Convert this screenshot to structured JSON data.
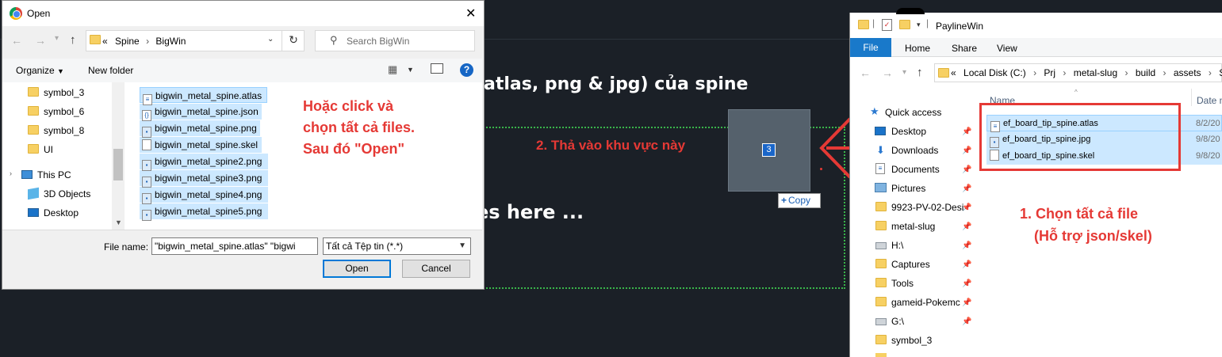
{
  "background_page": {
    "heading_fragment": "atlas, png & jpg) của spine",
    "drop_text_fragment": "es here ...",
    "drop_hint": "2. Thả vào khu vực này",
    "drag_count": "3",
    "copy_tooltip": "Copy",
    "colors": {
      "dropzone_border": "#39b54a",
      "annotation": "#e53935",
      "page_bg": "#1b2027"
    }
  },
  "open_dialog": {
    "title": "Open",
    "breadcrumb_prefix": "«",
    "breadcrumb": [
      "Spine",
      "BigWin"
    ],
    "search_placeholder": "Search BigWin",
    "toolbar": {
      "organize": "Organize",
      "new_folder": "New folder",
      "help": "?"
    },
    "nav_items": [
      {
        "label": "symbol_3",
        "icon": "folder-icon"
      },
      {
        "label": "symbol_6",
        "icon": "folder-icon"
      },
      {
        "label": "symbol_8",
        "icon": "folder-icon"
      },
      {
        "label": "UI",
        "icon": "folder-icon"
      },
      {
        "label": "This PC",
        "icon": "pc-icon"
      },
      {
        "label": "3D Objects",
        "icon": "cube-icon"
      },
      {
        "label": "Desktop",
        "icon": "desktop-icon"
      }
    ],
    "files": [
      {
        "name": "bigwin_metal_spine.atlas",
        "icon": "text-file-icon"
      },
      {
        "name": "bigwin_metal_spine.json",
        "icon": "json-file-icon"
      },
      {
        "name": "bigwin_metal_spine.png",
        "icon": "image-file-icon"
      },
      {
        "name": "bigwin_metal_spine.skel",
        "icon": "generic-file-icon"
      },
      {
        "name": "bigwin_metal_spine2.png",
        "icon": "image-file-icon"
      },
      {
        "name": "bigwin_metal_spine3.png",
        "icon": "image-file-icon"
      },
      {
        "name": "bigwin_metal_spine4.png",
        "icon": "image-file-icon"
      },
      {
        "name": "bigwin_metal_spine5.png",
        "icon": "image-file-icon"
      }
    ],
    "annotation": "Hoặc click và\nchọn tất cả files.\nSau đó \"Open\"",
    "file_name_label": "File name:",
    "file_name_value": "\"bigwin_metal_spine.atlas\" \"bigwi",
    "file_type_value": "Tất cả Tệp tin (*.*)",
    "open_button": "Open",
    "cancel_button": "Cancel"
  },
  "explorer": {
    "title": "PaylineWin",
    "tabs": [
      "File",
      "Home",
      "Share",
      "View"
    ],
    "address_prefix": "«",
    "address": [
      "Local Disk (C:)",
      "Prj",
      "metal-slug",
      "build",
      "assets",
      "S"
    ],
    "nav_items": [
      {
        "label": "Quick access",
        "icon": "star-icon",
        "pinned": false
      },
      {
        "label": "Desktop",
        "icon": "desktop-icon",
        "pinned": true
      },
      {
        "label": "Downloads",
        "icon": "download-icon",
        "pinned": true
      },
      {
        "label": "Documents",
        "icon": "documents-icon",
        "pinned": true
      },
      {
        "label": "Pictures",
        "icon": "pictures-icon",
        "pinned": true
      },
      {
        "label": "9923-PV-02-Desi",
        "icon": "folder-icon",
        "pinned": true
      },
      {
        "label": "metal-slug",
        "icon": "folder-icon",
        "pinned": true
      },
      {
        "label": "H:\\",
        "icon": "drive-icon",
        "pinned": true
      },
      {
        "label": "Captures",
        "icon": "folder-icon",
        "pinned": true
      },
      {
        "label": "Tools",
        "icon": "folder-icon",
        "pinned": true
      },
      {
        "label": "gameid-Pokemc",
        "icon": "folder-icon",
        "pinned": true
      },
      {
        "label": "G:\\",
        "icon": "drive-icon",
        "pinned": true
      },
      {
        "label": "symbol_3",
        "icon": "folder-icon",
        "pinned": false
      }
    ],
    "columns": {
      "name": "Name",
      "date": "Date m"
    },
    "files": [
      {
        "name": "ef_board_tip_spine.atlas",
        "date": "8/2/20",
        "icon": "text-file-icon"
      },
      {
        "name": "ef_board_tip_spine.jpg",
        "date": "9/8/20",
        "icon": "image-file-icon"
      },
      {
        "name": "ef_board_tip_spine.skel",
        "date": "9/8/20",
        "icon": "generic-file-icon"
      }
    ],
    "annotation_line1": "1. Chọn tất cả file",
    "annotation_line2": "(Hỗ trợ json/skel)"
  }
}
